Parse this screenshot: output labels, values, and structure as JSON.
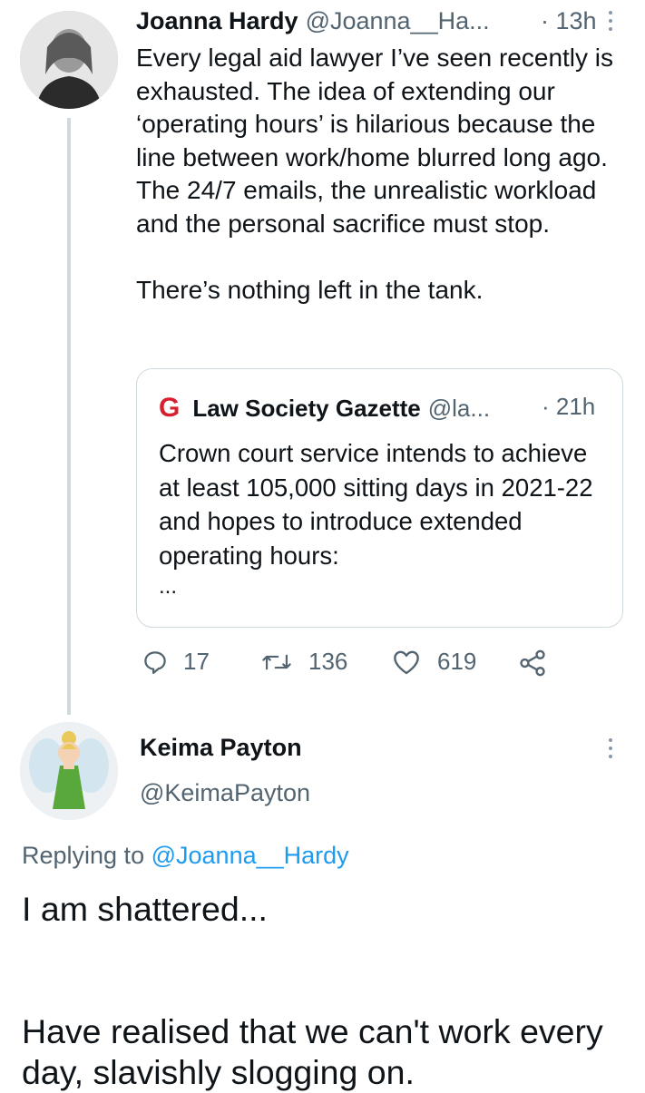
{
  "tweet": {
    "author_name": "Joanna Hardy",
    "author_handle": "@Joanna__Ha...",
    "time": "· 13h",
    "text": "Every legal aid lawyer I’ve seen recently is exhausted. The idea of extending our ‘operating hours’ is hilarious because the line between work/home blurred long ago. The 24/7 emails, the unrealistic workload and the personal sacrifice must stop.\n\nThere’s nothing left in the tank.",
    "quote": {
      "logo_letter": "G",
      "author_name": "Law Society Gazette",
      "author_handle": "@la...",
      "time": "· 21h",
      "text": "Crown court service intends to achieve at least 105,000 sitting days in 2021-22 and hopes to introduce extended operating hours:",
      "ellipsis": "..."
    },
    "actions": {
      "replies": "17",
      "retweets": "136",
      "likes": "619"
    }
  },
  "reply": {
    "author_name": "Keima Payton",
    "author_handle": "@KeimaPayton",
    "replying_prefix": "Replying to",
    "replying_handle": "@Joanna__Hardy",
    "text": "I am shattered...\n\n\nHave realised that we can't work every day, slavishly slogging on."
  },
  "colors": {
    "accent": "#1d9bf0",
    "gazette_red": "#d6202f",
    "muted": "#536471",
    "line": "#cfd9de"
  }
}
